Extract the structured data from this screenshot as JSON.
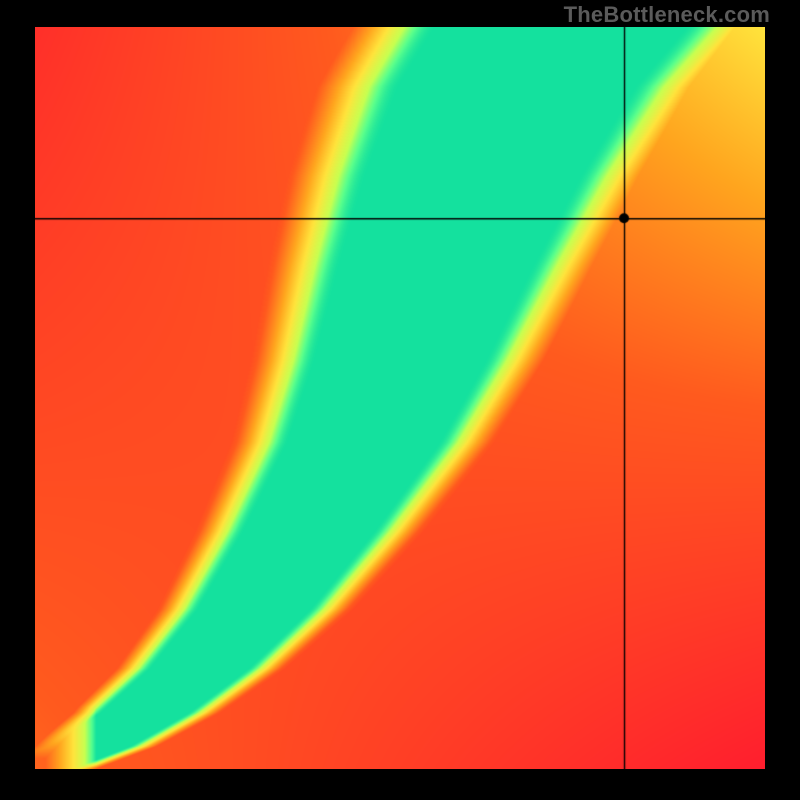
{
  "watermark": "TheBottleneck.com",
  "chart_data": {
    "type": "heatmap",
    "title": "",
    "xlabel": "",
    "ylabel": "",
    "xlim": [
      0,
      1
    ],
    "ylim": [
      0,
      1
    ],
    "crosshair": {
      "x": 0.808,
      "y": 0.742
    },
    "colorscale": {
      "stops": [
        {
          "value": 0.0,
          "color": "#ff1e2e"
        },
        {
          "value": 0.35,
          "color": "#ff5a1e"
        },
        {
          "value": 0.55,
          "color": "#ffa51e"
        },
        {
          "value": 0.72,
          "color": "#ffe43c"
        },
        {
          "value": 0.86,
          "color": "#c8ff50"
        },
        {
          "value": 0.94,
          "color": "#5aff8c"
        },
        {
          "value": 1.0,
          "color": "#14e19e"
        }
      ]
    },
    "ridge": {
      "points": [
        {
          "x": 0.0,
          "y": 0.0
        },
        {
          "x": 0.075,
          "y": 0.03
        },
        {
          "x": 0.15,
          "y": 0.075
        },
        {
          "x": 0.225,
          "y": 0.135
        },
        {
          "x": 0.3,
          "y": 0.215
        },
        {
          "x": 0.375,
          "y": 0.32
        },
        {
          "x": 0.45,
          "y": 0.44
        },
        {
          "x": 0.5,
          "y": 0.55
        },
        {
          "x": 0.55,
          "y": 0.68
        },
        {
          "x": 0.6,
          "y": 0.8
        },
        {
          "x": 0.66,
          "y": 0.92
        },
        {
          "x": 0.72,
          "y": 1.0
        }
      ],
      "half_width": {
        "base": 0.05,
        "growth": 0.12
      }
    },
    "background_gradient": {
      "top_left": 0.1,
      "top_right": 0.72,
      "bottom_left": 0.38,
      "bottom_right": 0.0
    },
    "legend": null
  }
}
